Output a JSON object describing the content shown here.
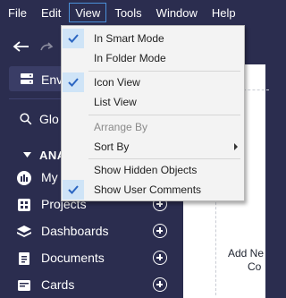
{
  "menubar": {
    "items": [
      "File",
      "Edit",
      "View",
      "Tools",
      "Window",
      "Help"
    ],
    "active": "View"
  },
  "toolbar": {
    "icons": [
      "undo-icon",
      "redo-icon"
    ]
  },
  "sidebar": {
    "environment_label": "Envi",
    "search_label": "Glo",
    "section_label": "ANA",
    "items": [
      {
        "label": "My",
        "icon": "my-icon"
      },
      {
        "label": "Projects",
        "icon": "projects-icon"
      },
      {
        "label": "Dashboards",
        "icon": "dashboards-icon"
      },
      {
        "label": "Documents",
        "icon": "documents-icon"
      },
      {
        "label": "Cards",
        "icon": "cards-icon"
      }
    ]
  },
  "content": {
    "add_new_line1": "Add Ne",
    "add_new_line2": "Co"
  },
  "view_menu": {
    "items": [
      {
        "label": "In Smart Mode",
        "checked": true,
        "enabled": true
      },
      {
        "label": "In Folder Mode",
        "checked": false,
        "enabled": true
      },
      {
        "label": "Icon View",
        "checked": true,
        "enabled": true
      },
      {
        "label": "List View",
        "checked": false,
        "enabled": true
      },
      {
        "label": "Arrange By",
        "checked": false,
        "enabled": false
      },
      {
        "label": "Sort By",
        "checked": false,
        "enabled": true,
        "submenu": true
      },
      {
        "label": "Show Hidden Objects",
        "checked": false,
        "enabled": true
      },
      {
        "label": "Show User Comments",
        "checked": true,
        "enabled": true
      }
    ]
  },
  "colors": {
    "sidebar_bg": "#2b2d4f",
    "menu_bg": "#f3f3f3",
    "check_bg": "#cfe4f7",
    "check_color": "#2b66c2",
    "active_border": "#4a8fd8"
  }
}
